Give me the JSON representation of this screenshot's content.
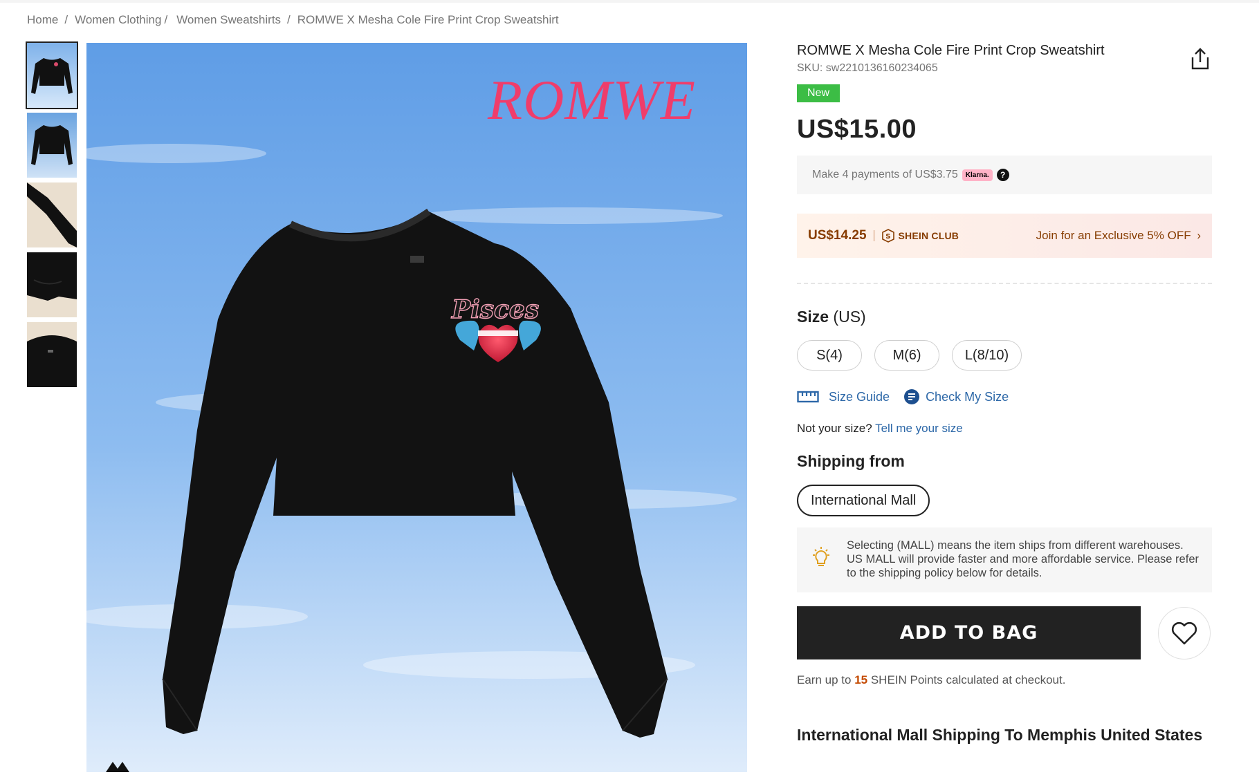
{
  "breadcrumb": {
    "home": "Home",
    "women_clothing": "Women Clothing",
    "women_sweatshirts": "Women Sweatshirts",
    "current": "ROMWE X Mesha Cole Fire Print Crop Sweatshirt",
    "sep": "/"
  },
  "gallery": {
    "brand_watermark": "ROMWE",
    "print_text": "Pisces"
  },
  "product": {
    "title": "ROMWE X Mesha Cole Fire Print Crop Sweatshirt",
    "sku": "SKU: sw2210136160234065",
    "badge": "New",
    "price": "US$15.00"
  },
  "klarna": {
    "text": "Make 4 payments of US$3.75",
    "logo": "Klarna.",
    "help": "?"
  },
  "club": {
    "price": "US$14.25",
    "name": "SHEIN CLUB",
    "join": "Join for an Exclusive 5% OFF"
  },
  "size": {
    "title": "Size",
    "unit": "(US)",
    "options": [
      "S(4)",
      "M(6)",
      "L(8/10)"
    ],
    "guide": "Size Guide",
    "check": "Check My Size",
    "not_your_size": "Not your size?",
    "tell_me": "Tell me your size"
  },
  "shipping": {
    "title": "Shipping from",
    "option": "International Mall",
    "info": "Selecting (MALL) means the item ships from different warehouses. US MALL will provide faster and more affordable service. Please refer to the shipping policy below for details."
  },
  "actions": {
    "add_to_bag": "ADD TO BAG"
  },
  "points": {
    "prefix": "Earn up to",
    "value": "15",
    "suffix": "SHEIN Points calculated at checkout."
  },
  "shipping_to": "International Mall Shipping To Memphis United States",
  "colors": {
    "new_badge": "#3cbd45",
    "club_text": "#873c00",
    "link": "#2d68a8",
    "points_value": "#c44a01",
    "add_to_bag_bg": "#222222"
  }
}
